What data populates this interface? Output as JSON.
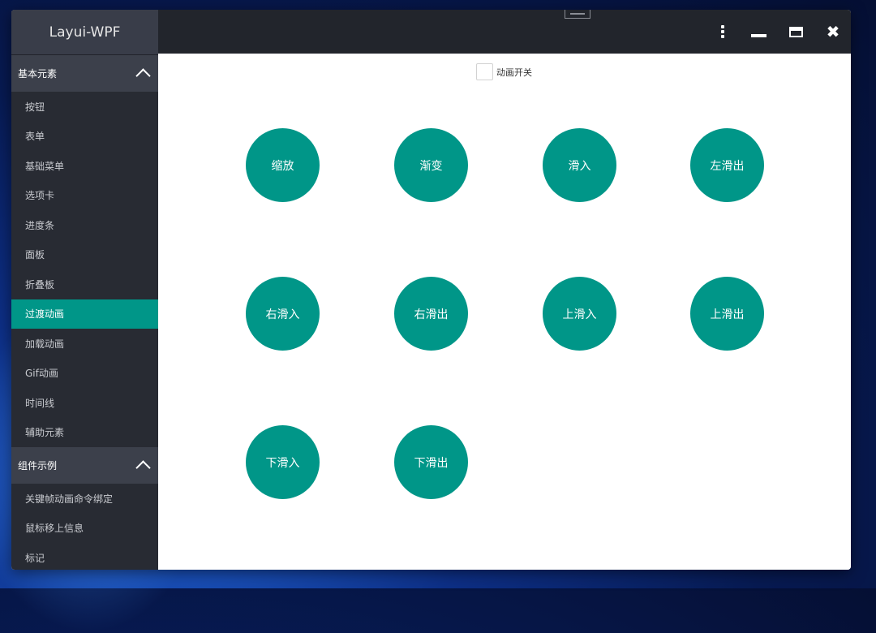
{
  "app": {
    "title": "Layui-WPF"
  },
  "sidebar": {
    "groups": [
      {
        "label": "基本元素",
        "expanded": true,
        "items": [
          "按钮",
          "表单",
          "基础菜单",
          "选项卡",
          "进度条",
          "面板",
          "折叠板",
          "过渡动画",
          "加载动画",
          "Gif动画",
          "时间线",
          "辅助元素"
        ]
      },
      {
        "label": "组件示例",
        "expanded": true,
        "items": [
          "关键帧动画命令绑定",
          "鼠标移上信息",
          "标记"
        ]
      }
    ],
    "active_item": "过渡动画"
  },
  "titlebar": {
    "icons": [
      "more-vertical-icon",
      "minimize-icon",
      "maximize-icon",
      "close-icon"
    ]
  },
  "content": {
    "toggle_label": "动画开关",
    "toggle_checked": false,
    "buttons": [
      "缩放",
      "渐变",
      "滑入",
      "左滑出",
      "右滑入",
      "右滑出",
      "上滑入",
      "上滑出",
      "下滑入",
      "下滑出"
    ]
  },
  "colors": {
    "accent": "#009688",
    "sidebar_bg": "#282b33",
    "group_header_bg": "#3c404b",
    "titlebar_bg": "#22252c"
  }
}
